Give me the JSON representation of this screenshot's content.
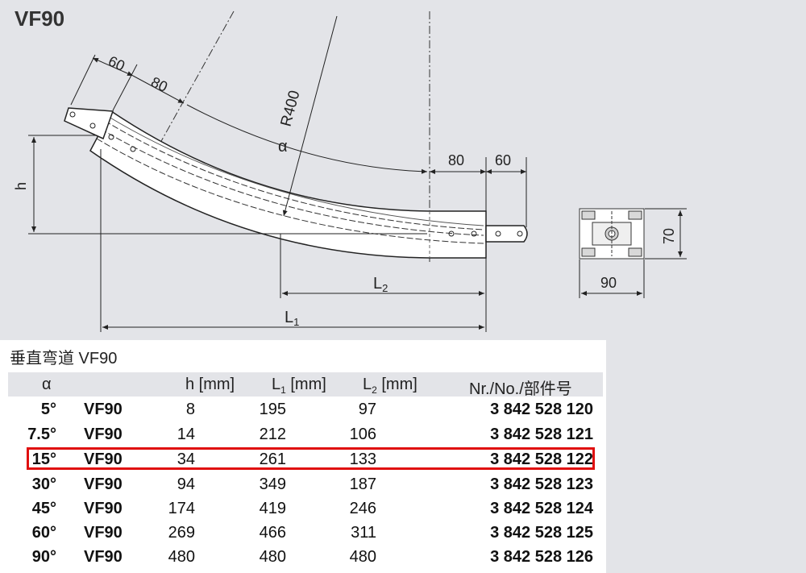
{
  "drawing": {
    "title": "VF90",
    "dims": {
      "d60_top": "60",
      "d80_top": "80",
      "alpha": "α",
      "radius": "R400",
      "d80_right": "80",
      "d60_right": "60",
      "h": "h",
      "l2": "L",
      "l2_sub": "2",
      "l1": "L",
      "l1_sub": "1",
      "d70": "70",
      "d90": "90"
    }
  },
  "table": {
    "title": "垂直弯道 VF90",
    "headers": {
      "alpha": "α",
      "h": "h [mm]",
      "l1": "L",
      "l1_sub": "1",
      "l1_unit": " [mm]",
      "l2": "L",
      "l2_sub": "2",
      "l2_unit": " [mm]",
      "nr": "Nr./No./部件号"
    },
    "rows": [
      {
        "alpha": "5°",
        "model": "VF90",
        "h": "8",
        "l1": "195",
        "l2": "97",
        "nr": "3 842 528 120"
      },
      {
        "alpha": "7.5°",
        "model": "VF90",
        "h": "14",
        "l1": "212",
        "l2": "106",
        "nr": "3 842 528 121"
      },
      {
        "alpha": "15°",
        "model": "VF90",
        "h": "34",
        "l1": "261",
        "l2": "133",
        "nr": "3 842 528 122"
      },
      {
        "alpha": "30°",
        "model": "VF90",
        "h": "94",
        "l1": "349",
        "l2": "187",
        "nr": "3 842 528 123"
      },
      {
        "alpha": "45°",
        "model": "VF90",
        "h": "174",
        "l1": "419",
        "l2": "246",
        "nr": "3 842 528 124"
      },
      {
        "alpha": "60°",
        "model": "VF90",
        "h": "269",
        "l1": "466",
        "l2": "311",
        "nr": "3 842 528 125"
      },
      {
        "alpha": "90°",
        "model": "VF90",
        "h": "480",
        "l1": "480",
        "l2": "480",
        "nr": "3 842 528 126"
      }
    ],
    "highlighted_row": 2,
    "highlight_color": "#e01010"
  }
}
